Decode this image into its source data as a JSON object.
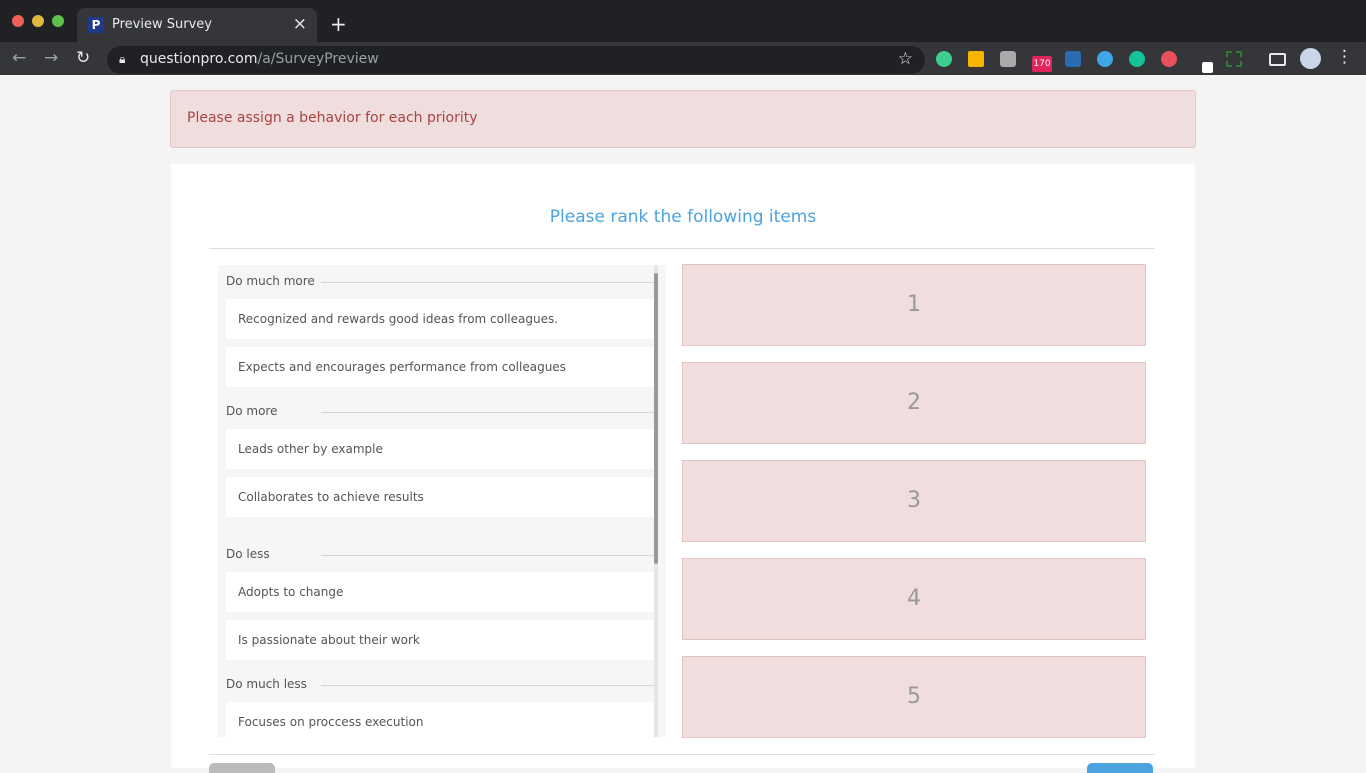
{
  "browser": {
    "tab_title": "Preview Survey",
    "url_host": "questionpro.com",
    "url_path": "/a/SurveyPreview",
    "ext_badge": "170"
  },
  "alert": "Please assign a behavior for each priority",
  "question": "Please rank the following items",
  "groups": [
    {
      "label": "Do much more",
      "items": [
        "Recognized and rewards good ideas from colleagues.",
        "Expects and encourages performance from colleagues"
      ]
    },
    {
      "label": "Do more",
      "items": [
        "Leads other by example",
        "Collaborates to achieve results"
      ]
    },
    {
      "label": "Do less",
      "items": [
        "Adopts to change",
        "Is passionate about their work"
      ]
    },
    {
      "label": "Do much less",
      "items": [
        "Focuses on proccess execution"
      ]
    }
  ],
  "ranks": [
    "1",
    "2",
    "3",
    "4",
    "5"
  ],
  "colors": {
    "accent": "#4aa3df",
    "alert_bg": "#f0dede",
    "alert_text": "#a94442"
  }
}
